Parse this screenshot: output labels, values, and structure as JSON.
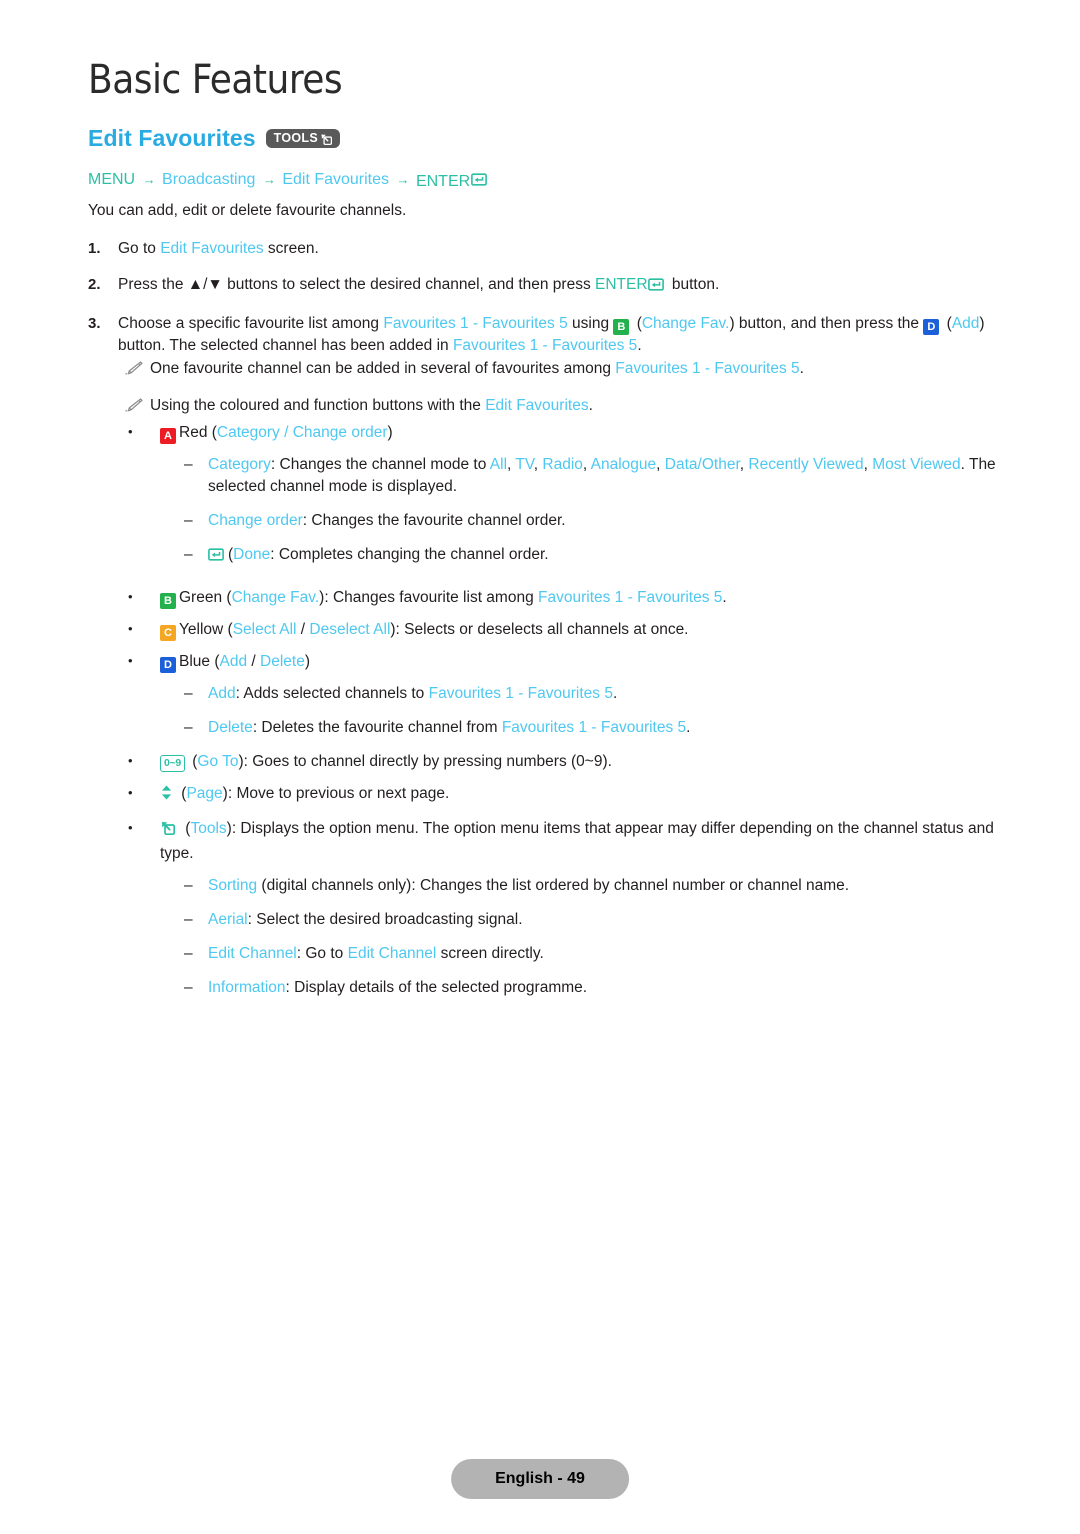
{
  "header": {
    "chapter_title": "Basic Features",
    "section_title": "Edit Favourites",
    "tools_badge_label": "TOOLS",
    "tools_icon": "tools-arrow-icon"
  },
  "breadcrumb": {
    "menu": "MENU",
    "arrow": "→",
    "broadcasting": "Broadcasting",
    "edit_favourites": "Edit Favourites",
    "enter": "ENTER",
    "enter_icon": "enter-return-icon"
  },
  "intro": "You can add, edit or delete favourite channels.",
  "steps": [
    {
      "num": "1.",
      "parts": [
        {
          "t": "Go to ",
          "c": "black"
        },
        {
          "t": "Edit Favourites",
          "c": "blue"
        },
        {
          "t": " screen.",
          "c": "black"
        }
      ]
    },
    {
      "num": "2.",
      "parts": [
        {
          "t": "Press the ▲/▼ buttons to select the desired channel, and then press ",
          "c": "black"
        },
        {
          "t": "ENTER",
          "c": "teal"
        },
        {
          "t": "[enter-icon]",
          "c": "icon"
        },
        {
          "t": " button.",
          "c": "black"
        }
      ]
    },
    {
      "num": "3.",
      "parts": [
        {
          "t": "Choose a specific favourite list among ",
          "c": "black"
        },
        {
          "t": "Favourites 1 - Favourites 5",
          "c": "blue"
        },
        {
          "t": " using ",
          "c": "black"
        },
        {
          "t": "[badge-B]",
          "c": "icon"
        },
        {
          "t": " (",
          "c": "black"
        },
        {
          "t": "Change Fav.",
          "c": "blue"
        },
        {
          "t": ") button, and then press the ",
          "c": "black"
        },
        {
          "t": "[badge-D]",
          "c": "icon"
        },
        {
          "t": " (",
          "c": "black"
        },
        {
          "t": "Add",
          "c": "blue"
        },
        {
          "t": ") button. The selected channel has been added in ",
          "c": "black"
        },
        {
          "t": "Favourites 1 - Favourites 5",
          "c": "blue"
        },
        {
          "t": ".",
          "c": "black"
        }
      ]
    }
  ],
  "notes": [
    {
      "icon": "pencil-note-icon",
      "text_before": "One favourite channel can be added in several of favourites among ",
      "highlight": "Favourites 1 - Favourites 5",
      "text_after": "."
    },
    {
      "icon": "pencil-note-icon",
      "text_before": "Using the coloured and function buttons with the ",
      "highlight": "Edit Favourites",
      "text_after": "."
    }
  ],
  "buttons": {
    "red": {
      "badge": "A",
      "badge_color": "#ed1c24",
      "label": "Red",
      "options_open": " (",
      "opt1": "Category",
      "sep": " / ",
      "opt2": "Change order",
      "options_close": ")",
      "sub": [
        {
          "dash": "–",
          "term": "Category",
          "text": ": Changes the channel mode to ",
          "modes": [
            "All",
            "TV",
            "Radio",
            "Analogue",
            "Data/Other",
            "Recently Viewed",
            "Most Viewed"
          ],
          "tail": ". The selected channel mode is displayed."
        },
        {
          "dash": "–",
          "term": "Change order",
          "text": ": Changes the favourite channel order.",
          "modes": [],
          "tail": ""
        },
        {
          "dash": "–",
          "icon": "enter-return-icon",
          "term": "Done",
          "text": ": Completes changing the channel order.",
          "modes": [],
          "tail": ""
        }
      ]
    },
    "green": {
      "badge": "B",
      "badge_color": "#22b14c",
      "label": "Green",
      "open": " (",
      "opt": "Change Fav.",
      "close": "): Changes favourite list among ",
      "range": "Favourites 1 - Favourites 5",
      "end": "."
    },
    "yellow": {
      "badge": "C",
      "badge_color": "#f5a623",
      "label": "Yellow",
      "open": " (",
      "opt1": "Select All",
      "sep": " / ",
      "opt2": "Deselect All",
      "close": "): Selects or deselects all channels at once."
    },
    "blue": {
      "badge": "D",
      "badge_color": "#1b5fd9",
      "label": "Blue",
      "open": " (",
      "opt1": "Add",
      "sep": " / ",
      "opt2": "Delete",
      "close": ")",
      "sub": [
        {
          "dash": "–",
          "term": "Add",
          "text": ": Adds selected channels to ",
          "range": "Favourites 1 - Favourites 5",
          "end": "."
        },
        {
          "dash": "–",
          "term": "Delete",
          "text": ": Deletes the favourite channel from ",
          "range": "Favourites 1 - Favourites 5",
          "end": "."
        }
      ]
    },
    "goto": {
      "badge_text": "0~9",
      "icon": "numeric-keys-icon",
      "open": " (",
      "term": "Go To",
      "close": "): Goes to channel directly by pressing numbers (0~9)."
    },
    "page": {
      "icon": "up-down-chevron-icon",
      "open": " (",
      "term": "Page",
      "close": "): Move to previous or next page."
    },
    "tools": {
      "icon": "tools-arrow-icon",
      "open": " (",
      "term": "Tools",
      "close": "): Displays the option menu. The option menu items that appear may differ depending on the channel status and type.",
      "sub": [
        {
          "dash": "–",
          "term": "Sorting",
          "text": " (digital channels only): Changes the list ordered by channel number or channel name."
        },
        {
          "dash": "–",
          "term": "Aerial",
          "text": ": Select the desired broadcasting signal."
        },
        {
          "dash": "–",
          "term": "Edit Channel",
          "text": ": Go to ",
          "term2": "Edit Channel",
          "text2": " screen directly."
        },
        {
          "dash": "–",
          "term": "Information",
          "text": ": Display details of the selected programme."
        }
      ]
    }
  },
  "footer": {
    "label": "English - 49"
  },
  "colors": {
    "heading_blue": "#29abe2",
    "link_blue": "#4ec8f0",
    "teal": "#2bbfa4",
    "text": "#231f20",
    "footer_bg": "#b3b3b3"
  }
}
